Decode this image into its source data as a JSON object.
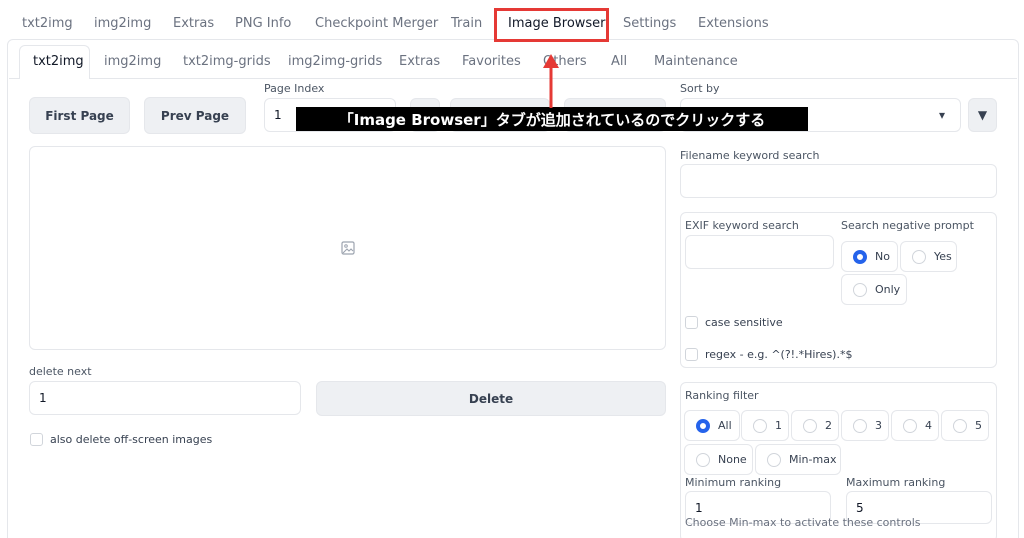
{
  "top_tabs": [
    "txt2img",
    "img2img",
    "Extras",
    "PNG Info",
    "Checkpoint Merger",
    "Train",
    "Image Browser",
    "Settings",
    "Extensions"
  ],
  "active_top_tab": "Image Browser",
  "sub_tabs": [
    "txt2img",
    "img2img",
    "txt2img-grids",
    "img2img-grids",
    "Extras",
    "Favorites",
    "Others",
    "All",
    "Maintenance"
  ],
  "active_sub_tab": "txt2img",
  "paging": {
    "first_page_label": "First Page",
    "prev_page_label": "Prev Page",
    "page_index_label": "Page Index",
    "page_index_value": "1"
  },
  "sort": {
    "label": "Sort by",
    "dropdown_arrow": "▾",
    "direction_arrow": "▼"
  },
  "filename_search": {
    "label": "Filename keyword search",
    "value": ""
  },
  "exif_search": {
    "label": "EXIF keyword search",
    "value": ""
  },
  "negative_prompt": {
    "label": "Search negative prompt",
    "options": [
      "No",
      "Yes",
      "Only"
    ],
    "selected": "No"
  },
  "case_sensitive_label": "case sensitive",
  "regex_label": "regex - e.g. ^(?!.*Hires).*$",
  "delete": {
    "delete_next_label": "delete next",
    "delete_next_value": "1",
    "delete_button": "Delete",
    "offscreen_label": "also delete off-screen images"
  },
  "ranking": {
    "label": "Ranking filter",
    "options": [
      "All",
      "1",
      "2",
      "3",
      "4",
      "5",
      "None",
      "Min-max"
    ],
    "selected": "All",
    "min_label": "Minimum ranking",
    "min_value": "1",
    "max_label": "Maximum ranking",
    "max_value": "5",
    "hint": "Choose Min-max to activate these controls"
  },
  "annotation_text": "「Image Browser」タブが追加されているのでクリックする",
  "colors": {
    "highlight": "#e53935",
    "radio_selected": "#2563eb"
  }
}
